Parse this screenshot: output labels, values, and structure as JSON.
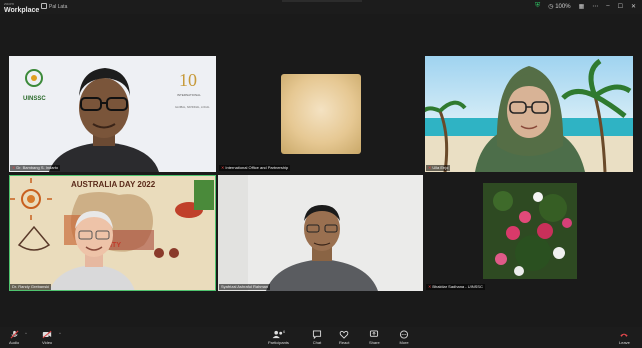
{
  "app": {
    "brand_top": "zoom",
    "brand_name": "Workplace"
  },
  "meeting": {
    "info_label": "Pal Lata"
  },
  "topbar": {
    "zoom_level": "100%",
    "view_label": "View"
  },
  "tiles": [
    {
      "name": "Dr. Bambang S. Indarto",
      "logo_text": "UINSSC",
      "anniv_text": "INTERNATIONAL",
      "anniv_sub": "GLOBAL, NATIONAL, LOCAL",
      "muted": true
    },
    {
      "name": "International Office and Partnership",
      "muted": true
    },
    {
      "name": "Ulla Enjo",
      "muted": true
    },
    {
      "name": "Dr. Randy Grebanski",
      "banner": "AUSTRALIA DAY 2022",
      "banner_sub": "UNIVERSITY",
      "muted": false,
      "active": true
    },
    {
      "name": "Syafrizal Ashraful Rahman",
      "muted": false
    },
    {
      "name": "Bhaktiar Sadhana - UINSSC",
      "muted": true
    }
  ],
  "toolbar": {
    "audio": "Audio",
    "video": "Video",
    "participants": "Participants",
    "participants_count": "6",
    "chat": "Chat",
    "react": "React",
    "share": "Share",
    "more": "More",
    "leave": "Leave"
  },
  "colors": {
    "accent": "#4fc46f",
    "leave": "#e5484d",
    "muted_mic": "#e04040"
  }
}
